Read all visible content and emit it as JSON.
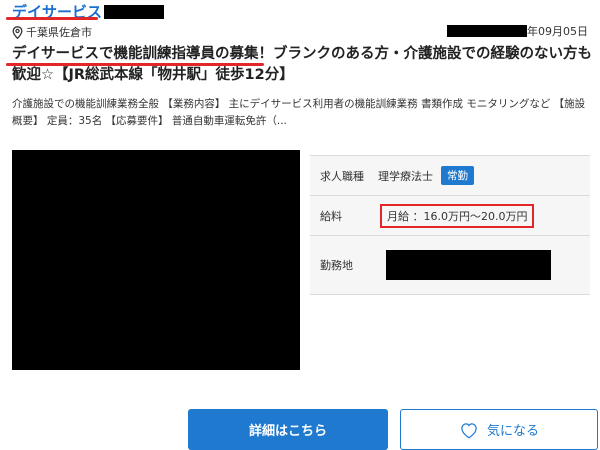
{
  "header": {
    "facility_name": "デイサービス",
    "location": "千葉県佐倉市",
    "date_suffix": "年09月05日"
  },
  "job": {
    "title": "デイサービスで機能訓練指導員の募集！ブランクのある方・介護施設での経験のない方も歓迎☆【JR総武本線「物井駅」徒歩12分】",
    "description": "介護施設での機能訓練業務全般 【業務内容】 主にデイサービス利用者の機能訓練業務 書類作成 モニタリングなど 【施設概要】 定員：35名 【応募要件】 普通自動車運転免許（..."
  },
  "info": {
    "occupation_label": "求人職種",
    "occupation_value": "理学療法士",
    "employment_badge": "常勤",
    "salary_label": "給料",
    "salary_value": "月給 ：16.0万円〜20.0万円",
    "location_label": "勤務地"
  },
  "buttons": {
    "detail_label": "詳細はこちら",
    "favorite_label": "気になる"
  },
  "colors": {
    "link_blue": "#1a6fcf",
    "button_blue": "#1e79cf",
    "highlight_red": "#e3262a",
    "table_bg": "#f6f6f6"
  },
  "icons": {
    "location": "map-pin-icon",
    "favorite": "heart-icon"
  }
}
